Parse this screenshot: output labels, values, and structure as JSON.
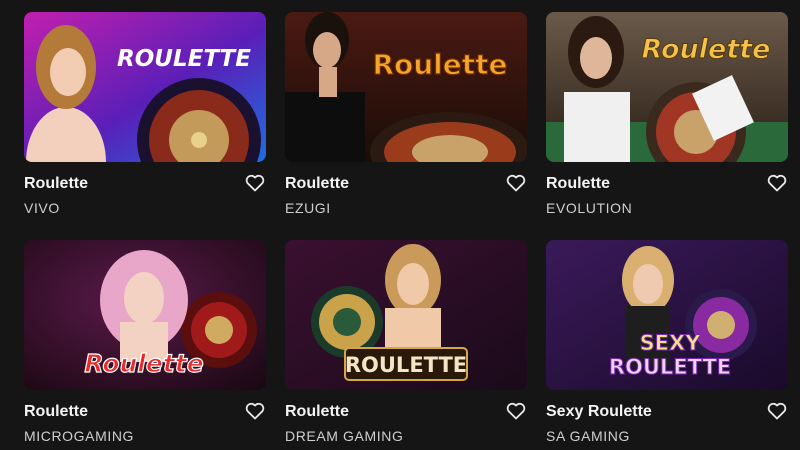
{
  "games": [
    {
      "title": "Roulette",
      "provider": "VIVO",
      "logo": "ROULETTE"
    },
    {
      "title": "Roulette",
      "provider": "EZUGI",
      "logo": "Roulette"
    },
    {
      "title": "Roulette",
      "provider": "EVOLUTION",
      "logo": "Roulette"
    },
    {
      "title": "Roulette",
      "provider": "MICROGAMING",
      "logo": "Roulette"
    },
    {
      "title": "Roulette",
      "provider": "DREAM GAMING",
      "logo": "ROULETTE"
    },
    {
      "title": "Sexy Roulette",
      "provider": "SA GAMING",
      "logo_line1": "SEXY",
      "logo_line2": "ROULETTE"
    }
  ],
  "icons": {
    "favorite": "heart-outline-icon"
  },
  "colors": {
    "background": "#151515",
    "text": "#f4f4f4",
    "subtext": "#cfcfcf"
  }
}
